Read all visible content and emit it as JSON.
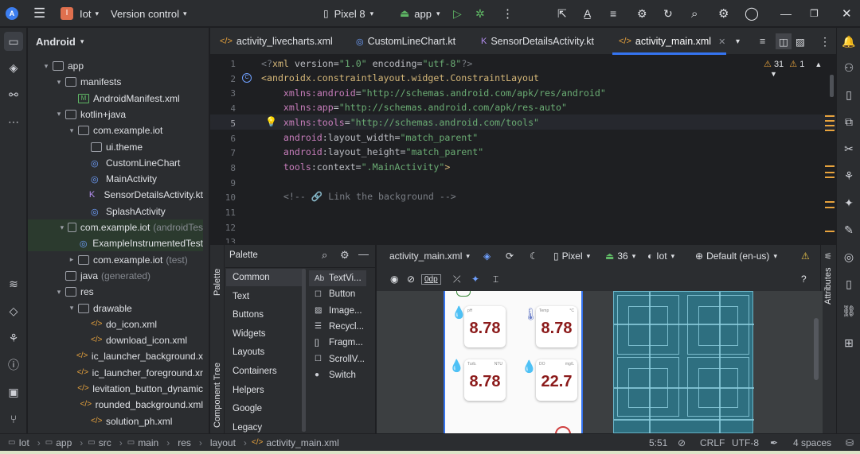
{
  "topbar": {
    "project_initial": "I",
    "project_name": "Iot",
    "vcs": "Version control",
    "device": "Pixel 8",
    "run_config": "app"
  },
  "project_panel": {
    "title": "Android",
    "tree": [
      {
        "label": "app",
        "type": "folder",
        "arrow": "▾"
      },
      {
        "label": "manifests",
        "type": "folder",
        "arrow": "▾"
      },
      {
        "label": "AndroidManifest.xml",
        "type": "manifest",
        "arrow": ""
      },
      {
        "label": "kotlin+java",
        "type": "folder",
        "arrow": "▾"
      },
      {
        "label": "com.example.iot",
        "type": "package",
        "arrow": "▾"
      },
      {
        "label": "ui.theme",
        "type": "package",
        "arrow": ""
      },
      {
        "label": "CustomLineChart",
        "type": "kt",
        "arrow": ""
      },
      {
        "label": "MainActivity",
        "type": "kt",
        "arrow": ""
      },
      {
        "label": "SensorDetailsActivity.kt",
        "type": "ktc",
        "arrow": ""
      },
      {
        "label": "SplashActivity",
        "type": "kt",
        "arrow": ""
      },
      {
        "label": "com.example.iot",
        "suffix": "(androidTes",
        "type": "package",
        "arrow": "▾"
      },
      {
        "label": "ExampleInstrumentedTest",
        "type": "kt",
        "arrow": ""
      },
      {
        "label": "com.example.iot",
        "suffix": "(test)",
        "type": "package",
        "arrow": "▸"
      },
      {
        "label": "java",
        "suffix": "(generated)",
        "type": "folder",
        "arrow": ""
      },
      {
        "label": "res",
        "type": "folder",
        "arrow": "▾"
      },
      {
        "label": "drawable",
        "type": "folder",
        "arrow": "▾"
      },
      {
        "label": "do_icon.xml",
        "type": "xml",
        "arrow": ""
      },
      {
        "label": "download_icon.xml",
        "type": "xml",
        "arrow": ""
      },
      {
        "label": "ic_launcher_background.x",
        "type": "xml",
        "arrow": ""
      },
      {
        "label": "ic_launcher_foreground.xr",
        "type": "xml",
        "arrow": ""
      },
      {
        "label": "levitation_button_dynamic",
        "type": "xml",
        "arrow": ""
      },
      {
        "label": "rounded_background.xml",
        "type": "xml",
        "arrow": ""
      },
      {
        "label": "solution_ph.xml",
        "type": "xml",
        "arrow": ""
      }
    ]
  },
  "tabs": [
    {
      "label": "activity_livecharts.xml",
      "icon": "</>"
    },
    {
      "label": "CustomLineChart.kt",
      "icon": "◎"
    },
    {
      "label": "SensorDetailsActivity.kt",
      "icon": "K"
    },
    {
      "label": "activity_main.xml",
      "icon": "</>",
      "active": true
    }
  ],
  "editor": {
    "warnings": "31",
    "weak_warnings": "1",
    "line_numbers": [
      "1",
      "2",
      "3",
      "4",
      "5",
      "6",
      "7",
      "8",
      "9",
      "10",
      "11",
      "12",
      "13"
    ]
  },
  "palette": {
    "title": "Palette",
    "side_tab_palette": "Palette",
    "side_tab_tree": "Component Tree",
    "categories": [
      "Common",
      "Text",
      "Buttons",
      "Widgets",
      "Layouts",
      "Containers",
      "Helpers",
      "Google",
      "Legacy"
    ],
    "items": [
      {
        "icon": "Ab",
        "label": "TextVi..."
      },
      {
        "icon": "☐",
        "label": "Button"
      },
      {
        "icon": "▨",
        "label": "Image..."
      },
      {
        "icon": "☰",
        "label": "Recycl..."
      },
      {
        "icon": "[]",
        "label": "Fragm..."
      },
      {
        "icon": "☐",
        "label": "ScrollV..."
      },
      {
        "icon": "●",
        "label": "Switch"
      }
    ]
  },
  "designer": {
    "file": "activity_main.xml",
    "device": "Pixel",
    "api": "36",
    "theme": "Iot",
    "locale": "Default (en-us)",
    "margin": "0dp",
    "attributes_tab": "Attributes"
  },
  "preview_cards": [
    {
      "label": "pH",
      "unit": "",
      "value": "8.78"
    },
    {
      "label": "Temp",
      "unit": "°C",
      "value": "8.78"
    },
    {
      "label": "Turb.",
      "unit": "NTU",
      "value": "8.78"
    },
    {
      "label": "DO",
      "unit": "mg/L",
      "value": "22.7"
    }
  ],
  "statusbar": {
    "crumbs": [
      "Iot",
      "app",
      "src",
      "main",
      "res",
      "layout",
      "activity_main.xml"
    ],
    "position": "5:51",
    "line_sep": "CRLF",
    "encoding": "UTF-8",
    "indent": "4 spaces"
  },
  "colors": {
    "accent": "#3574f0",
    "warning": "#e8a33d",
    "run": "#5fb865"
  }
}
